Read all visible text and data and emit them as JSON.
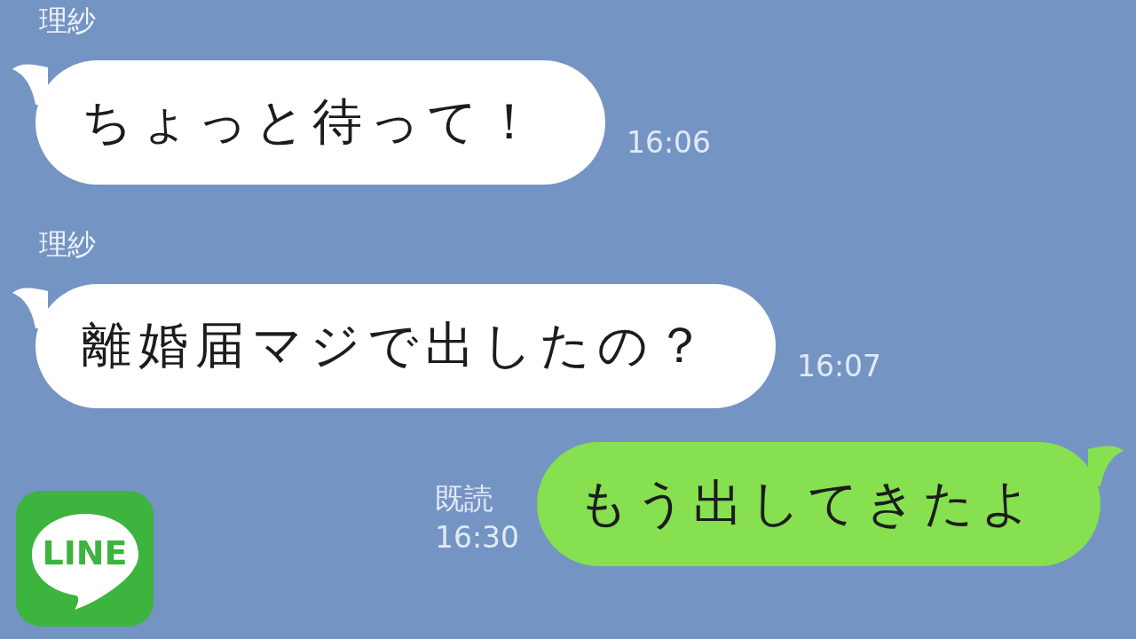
{
  "messages": [
    {
      "kind": "incoming",
      "sender": "理紗",
      "text": "ちょっと待って！",
      "time": "16:06"
    },
    {
      "kind": "incoming",
      "sender": "理紗",
      "text": "離婚届マジで出したの？",
      "time": "16:07"
    },
    {
      "kind": "outgoing",
      "read": "既読",
      "text": "もう出してきたよ",
      "time": "16:30"
    }
  ],
  "logo": {
    "text": "LINE"
  }
}
